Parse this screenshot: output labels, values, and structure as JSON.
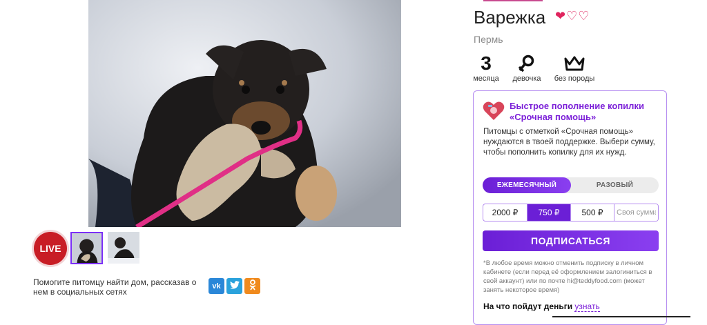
{
  "pet": {
    "name": "Варежка",
    "city": "Пермь",
    "hearts": [
      "❤",
      "♡",
      "♡"
    ],
    "stats": {
      "age_value": "3",
      "age_label": "месяца",
      "gender_label": "девочка",
      "breed_label": "без породы"
    }
  },
  "gallery": {
    "live_label": "LIVE",
    "thumbnail_count": 2
  },
  "share": {
    "text": "Помогите питомцу найти дом, рассказав о нем в социальных сетях",
    "vk": "vk",
    "twitter": "t",
    "ok": "ok"
  },
  "donate": {
    "title": "Быстрое пополнение копилки «Срочная помощь»",
    "description": "Питомцы с отметкой «Срочная помощь» нуждаются в твоей поддержке. Выбери сумму, чтобы пополнить копилку для их нужд.",
    "period_monthly": "ЕЖЕМЕСЯЧНЫЙ",
    "period_once": "РАЗОВЫЙ",
    "amounts": [
      "2000 ₽",
      "750 ₽",
      "500 ₽"
    ],
    "selected_amount_index": 1,
    "custom_placeholder": "Своя сумма",
    "subscribe_label": "ПОДПИСАТЬСЯ",
    "fine_print": "*В любое время можно отменить подписку в личном кабинете (если перед её оформлением залогиниться в свой аккаунт) или по почте hi@teddyfood.com (может занять некоторое время)",
    "money_where": "На что пойдут деньги",
    "money_link": "узнать"
  },
  "colors": {
    "accent": "#6b1fd6",
    "live_red": "#c81d25",
    "heart": "#e0245e"
  }
}
